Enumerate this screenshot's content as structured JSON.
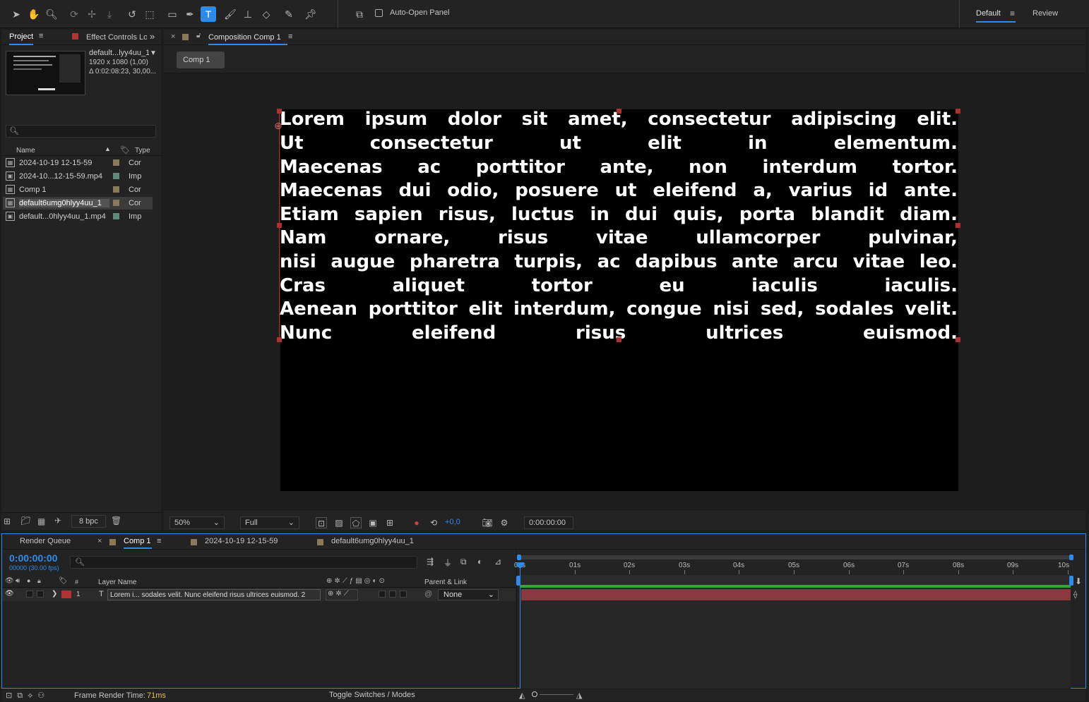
{
  "toolbar": {
    "auto_open_label": "Auto-Open Panel",
    "workspace_default": "Default",
    "workspace_review": "Review"
  },
  "project_panel": {
    "tab_project": "Project",
    "tab_effect_controls": "Effect Controls Lo",
    "thumb_name": "default...lyy4uu_1",
    "thumb_size": "1920 x 1080 (1,00)",
    "thumb_duration": "Δ 0:02:08:23, 30,00...",
    "col_name": "Name",
    "col_type": "Type",
    "bpc": "8 bpc",
    "items": [
      {
        "name": "2024-10-19 12-15-59",
        "type": "Cor",
        "swatch": "#8a7a5a"
      },
      {
        "name": "2024-10...12-15-59.mp4",
        "type": "Imp",
        "swatch": "#5e8a7e"
      },
      {
        "name": "Comp 1",
        "type": "Cor",
        "swatch": "#8a7a5a"
      },
      {
        "name": "default6umg0hlyy4uu_1",
        "type": "Cor",
        "swatch": "#8a7a5a"
      },
      {
        "name": "default...0hlyy4uu_1.mp4",
        "type": "Imp",
        "swatch": "#5e8a7e"
      }
    ]
  },
  "composition_panel": {
    "tab_title": "Composition Comp 1",
    "breadcrumb": "Comp 1",
    "text_lines": [
      "Lorem ipsum dolor sit amet, consectetur adipiscing elit.",
      "Ut consectetur ut elit in elementum.",
      "Maecenas ac porttitor ante, non interdum tortor.",
      "Maecenas dui odio, posuere ut eleifend a, varius id ante.",
      "Etiam sapien risus, luctus in dui quis, porta blandit diam.",
      "Nam ornare, risus vitae ullamcorper pulvinar,",
      "nisi augue pharetra turpis, ac dapibus ante arcu vitae leo.",
      "Cras aliquet tortor eu iaculis iaculis.",
      "Aenean porttitor elit interdum, congue nisi sed, sodales velit.",
      "Nunc eleifend risus ultrices euismod."
    ],
    "zoom": "50%",
    "resolution": "Full",
    "exposure": "+0,0",
    "timecode": "0:00:00:00"
  },
  "timeline": {
    "tab_render_queue": "Render Queue",
    "tab_comp1": "Comp 1",
    "tab_2024": "2024-10-19 12-15-59",
    "tab_default": "default6umg0hlyy4uu_1",
    "current_time": "0:00:00:00",
    "frame_info": "00000 (30.00 fps)",
    "col_number": "#",
    "col_layer_name": "Layer Name",
    "col_parent": "Parent & Link",
    "layer_index": "1",
    "layer_name": "Lorem i... sodales velit. Nunc eleifend risus ultrices euismod. 2",
    "parent_value": "None",
    "ruler_labels": [
      "00s",
      "01s",
      "02s",
      "03s",
      "04s",
      "05s",
      "06s",
      "07s",
      "08s",
      "09s",
      "10s"
    ],
    "frame_render_label": "Frame Render Time:",
    "frame_render_value": "71ms",
    "toggle_label": "Toggle Switches / Modes",
    "accent_color": "#2d8ceb",
    "layer_bar_color": "#8a3a3e",
    "work_area_color": "#3ca03c"
  }
}
